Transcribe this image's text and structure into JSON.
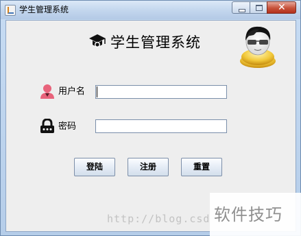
{
  "window": {
    "title": "学生管理系统"
  },
  "header": {
    "title": "学生管理系统",
    "logo_icon": "graduation-cap-icon",
    "avatar_icon": "user-with-glasses-avatar"
  },
  "form": {
    "username_label": "用户名",
    "username_icon": "user-icon",
    "username_value": "",
    "password_label": "密码",
    "password_icon": "lock-icon",
    "password_value": ""
  },
  "buttons": {
    "login": "登陆",
    "register": "注册",
    "reset": "重置"
  },
  "watermark": {
    "url_text": "http://blog.csd",
    "brand_text": "软件技巧"
  },
  "colors": {
    "user_icon": "#e8637b",
    "title_bar": "#c4d7ee",
    "close_button": "#c7523a",
    "content_bg": "#eeeeee"
  }
}
